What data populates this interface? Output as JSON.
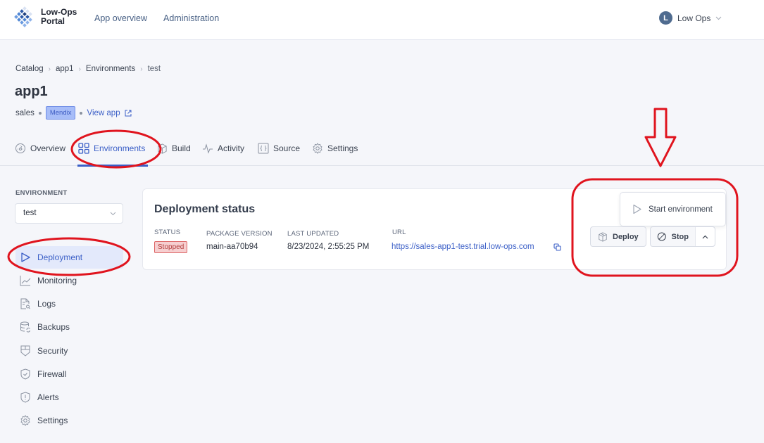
{
  "header": {
    "logo_line1": "Low-Ops",
    "logo_line2": "Portal",
    "nav": [
      "App overview",
      "Administration"
    ],
    "user_initial": "L",
    "user_name": "Low Ops"
  },
  "breadcrumb": [
    "Catalog",
    "app1",
    "Environments",
    "test"
  ],
  "page": {
    "title": "app1",
    "team": "sales",
    "platform_badge": "Mendix",
    "view_app_label": "View app"
  },
  "tabs": [
    {
      "label": "Overview",
      "icon": "gauge-icon"
    },
    {
      "label": "Environments",
      "icon": "grid-icon",
      "active": true
    },
    {
      "label": "Build",
      "icon": "package-icon"
    },
    {
      "label": "Activity",
      "icon": "activity-icon"
    },
    {
      "label": "Source",
      "icon": "braces-icon"
    },
    {
      "label": "Settings",
      "icon": "gear-icon"
    }
  ],
  "sidebar": {
    "environment_label": "ENVIRONMENT",
    "environment_selected": "test",
    "items": [
      {
        "label": "Deployment",
        "icon": "play-icon",
        "active": true
      },
      {
        "label": "Monitoring",
        "icon": "chart-line-icon"
      },
      {
        "label": "Logs",
        "icon": "file-search-icon"
      },
      {
        "label": "Backups",
        "icon": "database-refresh-icon"
      },
      {
        "label": "Security",
        "icon": "shield-panel-icon"
      },
      {
        "label": "Firewall",
        "icon": "shield-check-icon"
      },
      {
        "label": "Alerts",
        "icon": "shield-alert-icon"
      },
      {
        "label": "Settings",
        "icon": "gear-icon"
      }
    ]
  },
  "deployment": {
    "title": "Deployment status",
    "status_label": "STATUS",
    "status_value": "Stopped",
    "package_label": "PACKAGE VERSION",
    "package_value": "main-aa70b94",
    "updated_label": "LAST UPDATED",
    "updated_value": "8/23/2024, 2:55:25 PM",
    "url_label": "URL",
    "url_value": "https://sales-app1-test.trial.low-ops.com"
  },
  "actions": {
    "deploy_label": "Deploy",
    "stop_label": "Stop",
    "start_label": "Start environment"
  },
  "colors": {
    "accent": "#3b5fc7",
    "status_stopped_bg": "#f6cfd0",
    "status_stopped_text": "#b23c3c",
    "annotation_red": "#e0141e"
  }
}
